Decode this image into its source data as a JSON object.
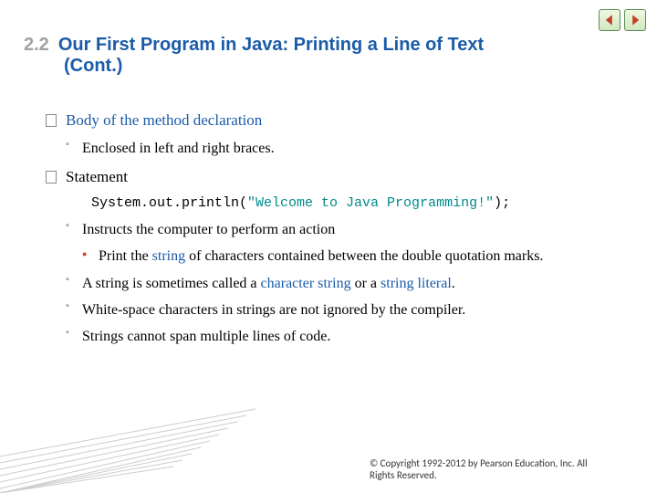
{
  "nav": {
    "prev_icon": "nav-prev-icon",
    "next_icon": "nav-next-icon"
  },
  "header": {
    "section_number": "2.2",
    "title_line1": "Our First Program in Java: Printing a Line of Text",
    "title_line2": "(Cont.)"
  },
  "content": {
    "b1": "Body of the method declaration",
    "b1_1": "Enclosed in left and right braces.",
    "b2": "Statement",
    "code_pre": "System.out.println(",
    "code_str": "\"Welcome to Java Programming!\"",
    "code_post": ");",
    "b2_1": "Instructs the computer to perform an action",
    "b2_1_1_a": "Print the ",
    "b2_1_1_kw": "string",
    "b2_1_1_b": " of characters contained between the double quotation marks.",
    "b2_2_a": "A string is sometimes called a ",
    "b2_2_kw1": "character string",
    "b2_2_b": " or a ",
    "b2_2_kw2": "string literal",
    "b2_2_c": ".",
    "b2_3": "White-space characters in strings are not ignored by the compiler.",
    "b2_4": "Strings cannot span multiple lines of code."
  },
  "footer": {
    "copyright": "© Copyright 1992-2012 by Pearson Education, Inc. All Rights Reserved."
  }
}
